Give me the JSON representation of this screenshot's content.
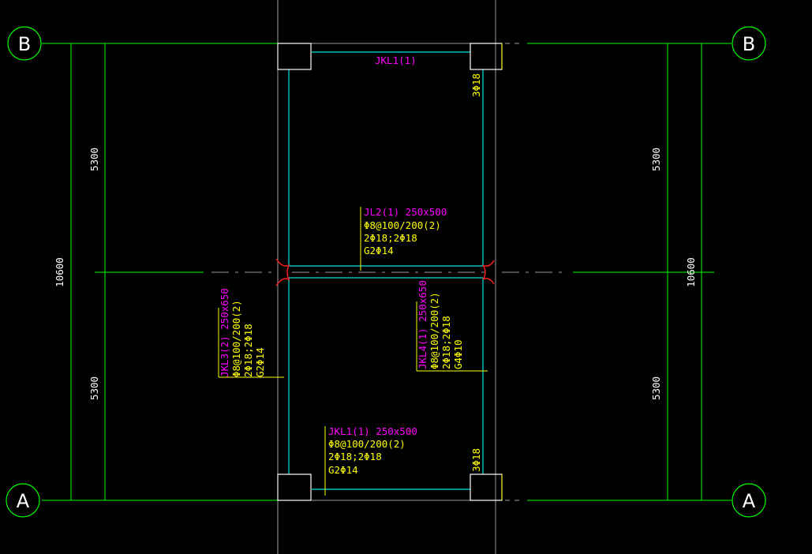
{
  "axes": {
    "a": "A",
    "b": "B"
  },
  "dimensions": {
    "left_total": "10600",
    "left_top": "5300",
    "left_bottom": "5300",
    "right_total": "10600",
    "right_top": "5300",
    "right_bottom": "5300"
  },
  "labels": {
    "jkl1_top": "JKL1(1)",
    "rebar_top_right": "3Φ18",
    "rebar_bottom_right": "3Φ18",
    "jl2": {
      "name": "JL2(1) 250x500",
      "l1": "Φ8@100/200(2)",
      "l2": "2Φ18;2Φ18",
      "l3": "G2Φ14"
    },
    "jkl3": {
      "name": "JKL3(2) 250x650",
      "l1": "Φ8@100/200(2)",
      "l2": "2Φ18;2Φ18",
      "l3": "G2Φ14"
    },
    "jkl4": {
      "name": "JKL4(1) 250x650",
      "l1": "Φ8@100/200(2)",
      "l2": "2Φ18;2Φ18",
      "l3": "G4Φ10"
    },
    "jkl1_bottom": {
      "name": "JKL1(1) 250x500",
      "l1": "Φ8@100/200(2)",
      "l2": "2Φ18;2Φ18",
      "l3": "G2Φ14"
    }
  },
  "colors": {
    "grid": "#00ff00",
    "gray": "#9a9a9a",
    "beam": "#00e5e5",
    "column": "#ffffff",
    "magenta": "#ff00ff",
    "yellow": "#ffff00",
    "red": "#ff2020"
  }
}
